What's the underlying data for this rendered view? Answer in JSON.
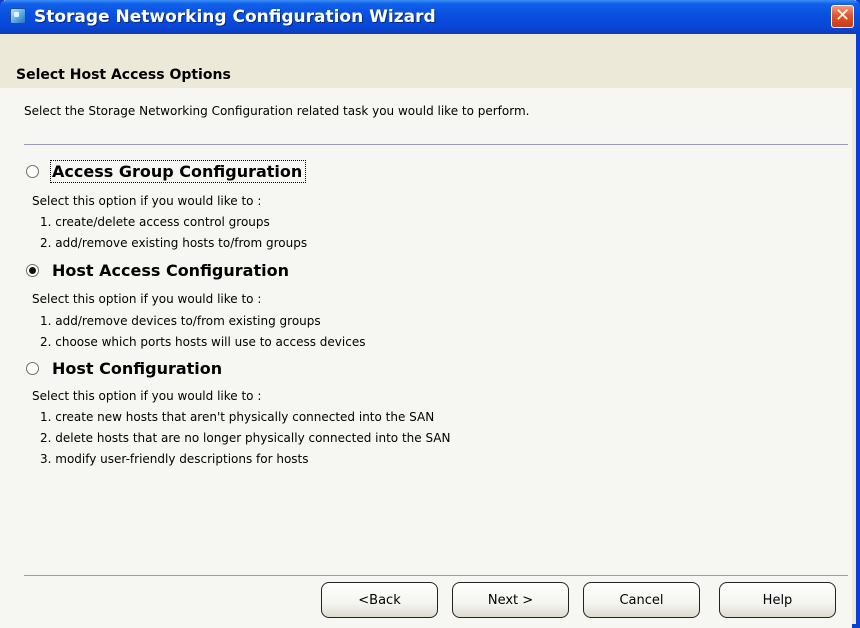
{
  "window": {
    "title": "Storage Networking Configuration Wizard",
    "close_glyph": "✕"
  },
  "header": {
    "title": "Select Host Access Options"
  },
  "instruction": "Select the Storage Networking Configuration related task you would like to perform.",
  "options": [
    {
      "label": "Access Group Configuration",
      "selected": false,
      "description": "Select this option if you would like to :",
      "items": [
        "1. create/delete access control groups",
        "2. add/remove existing hosts to/from groups"
      ]
    },
    {
      "label": "Host Access Configuration",
      "selected": true,
      "description": "Select this option if you would like to :",
      "items": [
        "1. add/remove devices to/from existing groups",
        "2. choose which ports hosts will use to access devices"
      ]
    },
    {
      "label": "Host Configuration",
      "selected": false,
      "description": "Select this option if you would like to :",
      "items": [
        "1. create new hosts that aren't physically connected into the SAN",
        "2. delete hosts that are no longer physically connected into the SAN",
        "3. modify user-friendly descriptions for hosts"
      ]
    }
  ],
  "buttons": {
    "back": "<Back",
    "next": "Next >",
    "cancel": "Cancel",
    "help": "Help"
  },
  "colors": {
    "titlebar": "#0a4fe0",
    "window_border": "#0a3fd6",
    "close": "#e2552c",
    "content_bg": "#f6f6f2"
  },
  "icons": {
    "app": "app-icon",
    "close": "close-icon"
  }
}
